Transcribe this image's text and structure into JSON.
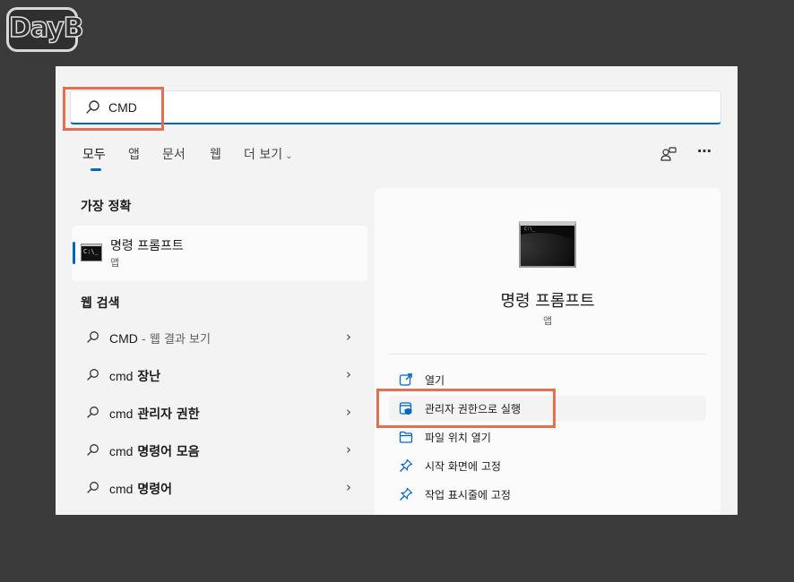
{
  "watermark": {
    "text": "DayB"
  },
  "search": {
    "value": "CMD",
    "icon": "search-icon"
  },
  "tabs": [
    {
      "label": "모두",
      "active": true
    },
    {
      "label": "앱"
    },
    {
      "label": "문서"
    },
    {
      "label": "웹"
    },
    {
      "label": "더 보기",
      "chevron": "chevron-down-icon"
    }
  ],
  "top_icons": [
    "account-switch-icon",
    "more-options-icon"
  ],
  "best_match": {
    "title": "가장 정확",
    "name": "명령 프롬프트",
    "type": "앱",
    "icon": "command-prompt-icon"
  },
  "web_search": {
    "title": "웹 검색",
    "items": [
      {
        "term": "CMD",
        "suffix": " - 웹 결과 보기"
      },
      {
        "term": "cmd",
        "suffix": " 장난"
      },
      {
        "term": "cmd",
        "suffix": " 관리자 권한"
      },
      {
        "term": "cmd",
        "suffix": " 명령어 모음"
      },
      {
        "term": "cmd",
        "suffix": " 명령어"
      }
    ]
  },
  "preview": {
    "name": "명령 프롬프트",
    "type": "앱",
    "actions": [
      {
        "label": "열기",
        "icon": "open-icon"
      },
      {
        "label": "관리자 권한으로 실행",
        "icon": "run-as-admin-icon"
      },
      {
        "label": "파일 위치 열기",
        "icon": "folder-icon"
      },
      {
        "label": "시작 화면에 고정",
        "icon": "pin-icon"
      },
      {
        "label": "작업 표시줄에 고정",
        "icon": "pin-icon"
      }
    ]
  },
  "colors": {
    "accent": "#0067c0",
    "highlight": "#e2704e",
    "background": "#3b3b3b",
    "panel": "#f3f3f3"
  }
}
